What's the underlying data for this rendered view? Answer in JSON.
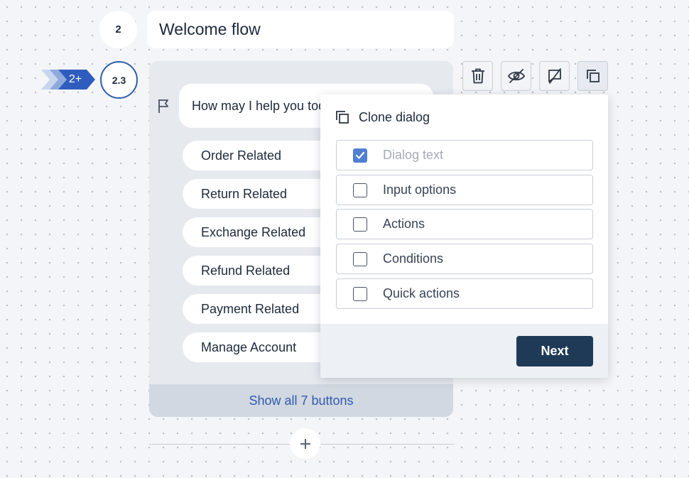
{
  "flow": {
    "step_number": "2",
    "title": "Welcome flow"
  },
  "node": {
    "incoming_label": "2+",
    "step_number": "2.3",
    "question": "How may I help you today?",
    "options": [
      "Order Related",
      "Return Related",
      "Exchange Related",
      "Refund Related",
      "Payment Related",
      "Manage Account"
    ],
    "show_all_label": "Show all 7 buttons"
  },
  "toolbar": {
    "icons": [
      "trash-icon",
      "eye-off-icon",
      "comment-off-icon",
      "copy-icon"
    ]
  },
  "clone_dialog": {
    "title": "Clone dialog",
    "options": [
      {
        "label": "Dialog text",
        "checked": true,
        "disabled": true
      },
      {
        "label": "Input options",
        "checked": false,
        "disabled": false
      },
      {
        "label": "Actions",
        "checked": false,
        "disabled": false
      },
      {
        "label": "Conditions",
        "checked": false,
        "disabled": false
      },
      {
        "label": "Quick actions",
        "checked": false,
        "disabled": false
      }
    ],
    "next_label": "Next"
  },
  "colors": {
    "primary_dark": "#1e3a56",
    "accent_blue": "#2f5da8",
    "link_blue": "#2d5bb0",
    "checkbox_blue": "#4f7fd1"
  }
}
